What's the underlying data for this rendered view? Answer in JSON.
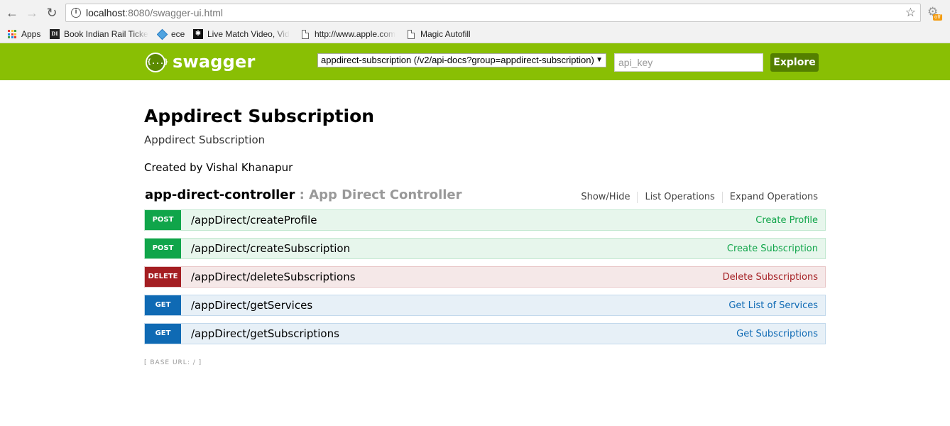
{
  "browser": {
    "url_host": "localhost",
    "url_rest": ":8080/swagger-ui.html",
    "extension_badge": "off",
    "bookmarks": [
      {
        "label": "Apps",
        "icon": "apps-grid-icon"
      },
      {
        "label": "Book Indian Rail Ticke",
        "icon": "di-icon"
      },
      {
        "label": "ece",
        "icon": "diamond-icon"
      },
      {
        "label": "Live Match Video, Vid",
        "icon": "star-bookmark-icon"
      },
      {
        "label": "http://www.apple.com",
        "icon": "page-icon"
      },
      {
        "label": "Magic Autofill",
        "icon": "page-icon"
      }
    ]
  },
  "header": {
    "logo_text": "swagger",
    "logo_glyph": "{...}",
    "api_select": "appdirect-subscription (/v2/api-docs?group=appdirect-subscription)",
    "api_key_placeholder": "api_key",
    "explore_label": "Explore",
    "brand_color": "#89bf04"
  },
  "info": {
    "title": "Appdirect Subscription",
    "description": "Appdirect Subscription",
    "created_by": "Created by Vishal Khanapur"
  },
  "controller": {
    "name": "app-direct-controller",
    "separator": " : ",
    "description": "App Direct Controller",
    "links": {
      "show_hide": "Show/Hide",
      "list_operations": "List Operations",
      "expand_operations": "Expand Operations"
    },
    "operations": [
      {
        "method": "POST",
        "path": "/appDirect/createProfile",
        "summary": "Create Profile"
      },
      {
        "method": "POST",
        "path": "/appDirect/createSubscription",
        "summary": "Create Subscription"
      },
      {
        "method": "DELETE",
        "path": "/appDirect/deleteSubscriptions",
        "summary": "Delete Subscriptions"
      },
      {
        "method": "GET",
        "path": "/appDirect/getServices",
        "summary": "Get List of Services"
      },
      {
        "method": "GET",
        "path": "/appDirect/getSubscriptions",
        "summary": "Get Subscriptions"
      }
    ]
  },
  "footer": {
    "base_url": "[ BASE URL: / ]"
  }
}
